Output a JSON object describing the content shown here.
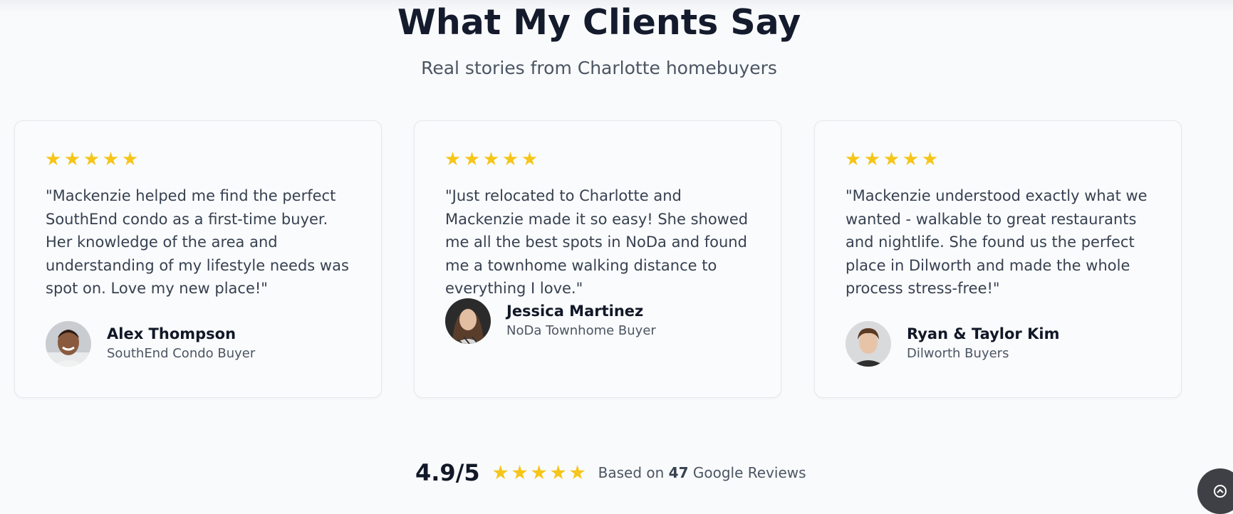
{
  "section": {
    "title": "What My Clients Say",
    "subtitle": "Real stories from Charlotte homebuyers"
  },
  "testimonials": [
    {
      "rating": 5,
      "quote": "\"Mackenzie helped me find the perfect SouthEnd condo as a first-time buyer. Her knowledge of the area and understanding of my lifestyle needs was spot on. Love my new place!\"",
      "name": "Alex Thompson",
      "role": "SouthEnd Condo Buyer"
    },
    {
      "rating": 5,
      "quote": "\"Just relocated to Charlotte and Mackenzie made it so easy! She showed me all the best spots in NoDa and found me a townhome walking distance to everything I love.\"",
      "name": "Jessica Martinez",
      "role": "NoDa Townhome Buyer"
    },
    {
      "rating": 5,
      "quote": "\"Mackenzie understood exactly what we wanted - walkable to great restaurants and nightlife. She found us the perfect place in Dilworth and made the whole process stress-free!\"",
      "name": "Ryan & Taylor Kim",
      "role": "Dilworth Buyers"
    }
  ],
  "summary": {
    "score": "4.9/5",
    "rating": 5,
    "based_prefix": "Based on",
    "count": "47",
    "based_suffix": "Google Reviews"
  },
  "colors": {
    "star": "#f5c518",
    "title": "#141b2d",
    "fab": "#3f3f46"
  },
  "icons": {
    "star": "star-icon",
    "fab": "chat-widget-icon"
  }
}
